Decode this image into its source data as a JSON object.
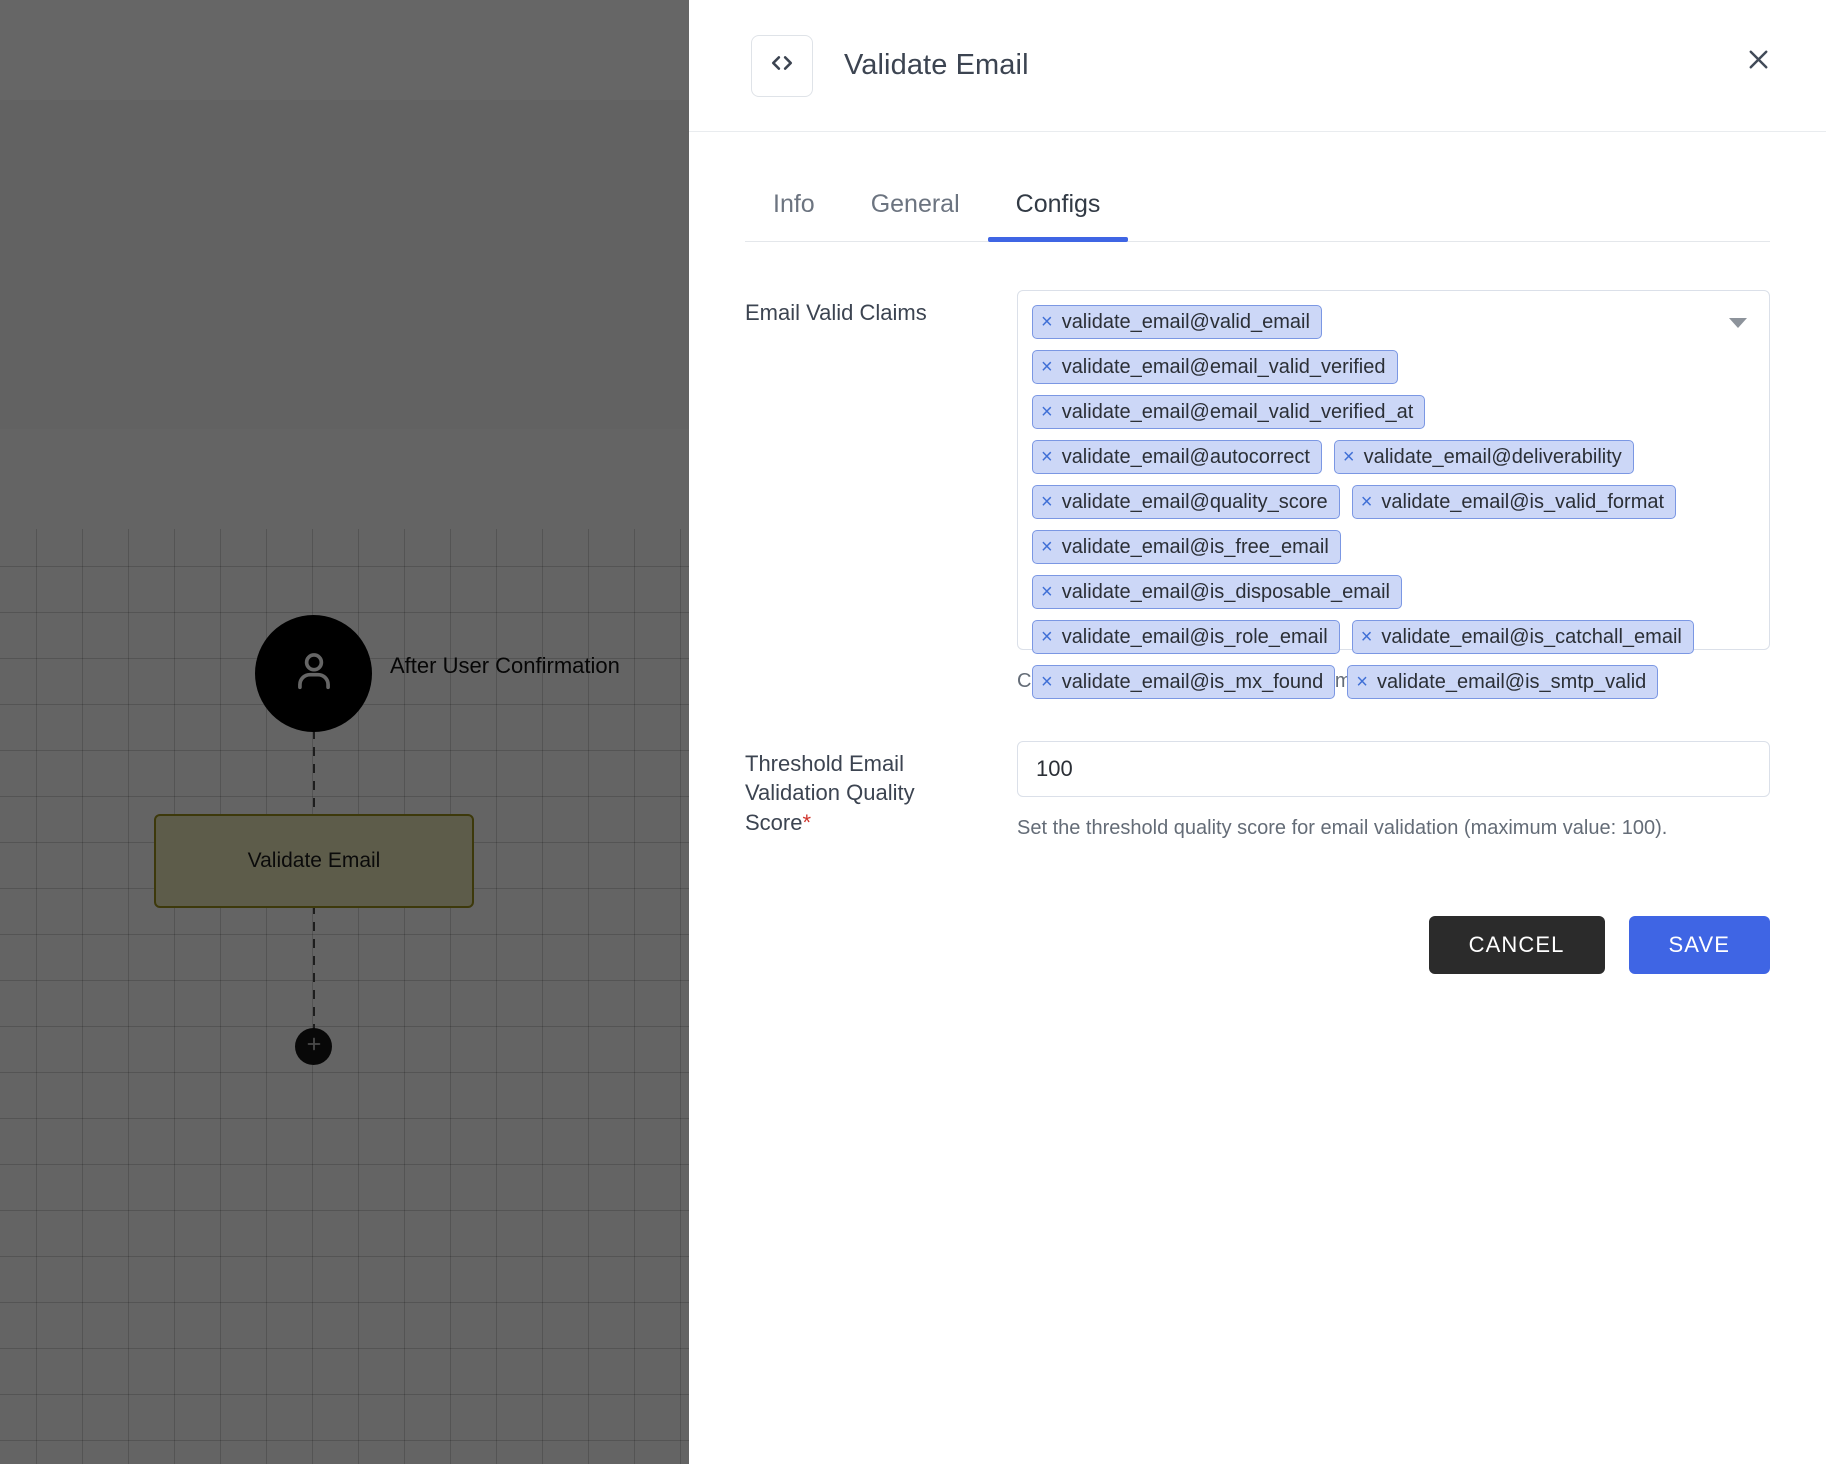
{
  "canvas": {
    "trigger_icon": "user-icon",
    "trigger_label": "After User Confirmation",
    "node_label": "Validate Email",
    "add_icon": "plus-icon"
  },
  "panel": {
    "icon": "code-brackets-icon",
    "title": "Validate Email",
    "close_icon": "close-icon",
    "tabs": [
      {
        "label": "Info",
        "active": false
      },
      {
        "label": "General",
        "active": false
      },
      {
        "label": "Configs",
        "active": true
      }
    ]
  },
  "form": {
    "claims": {
      "label": "Email Valid Claims",
      "caret_icon": "chevron-down-icon",
      "help": "Claims specified by the Claims parameter will be included in the tokens.",
      "chips": [
        "validate_email@valid_email",
        "validate_email@email_valid_verified",
        "validate_email@email_valid_verified_at",
        "validate_email@autocorrect",
        "validate_email@deliverability",
        "validate_email@quality_score",
        "validate_email@is_valid_format",
        "validate_email@is_free_email",
        "validate_email@is_disposable_email",
        "validate_email@is_role_email",
        "validate_email@is_catchall_email",
        "validate_email@is_mx_found",
        "validate_email@is_smtp_valid"
      ],
      "chip_remove_icon": "close-small-icon"
    },
    "threshold": {
      "label_line1": "Threshold Email",
      "label_line2": "Validation Quality",
      "label_line3": "Score",
      "required_marker": "*",
      "value": "100",
      "placeholder": "",
      "help": "Set the threshold quality score for email validation (maximum value: 100)."
    }
  },
  "actions": {
    "cancel_label": "CANCEL",
    "save_label": "SAVE"
  },
  "colors": {
    "accent_blue": "#3f65e4",
    "cancel_dark": "#2b2b2b",
    "chip_bg": "#ccd7f7",
    "chip_border": "#7b97e3",
    "required_red": "#d0342c",
    "node_border": "#9a8f1c"
  }
}
